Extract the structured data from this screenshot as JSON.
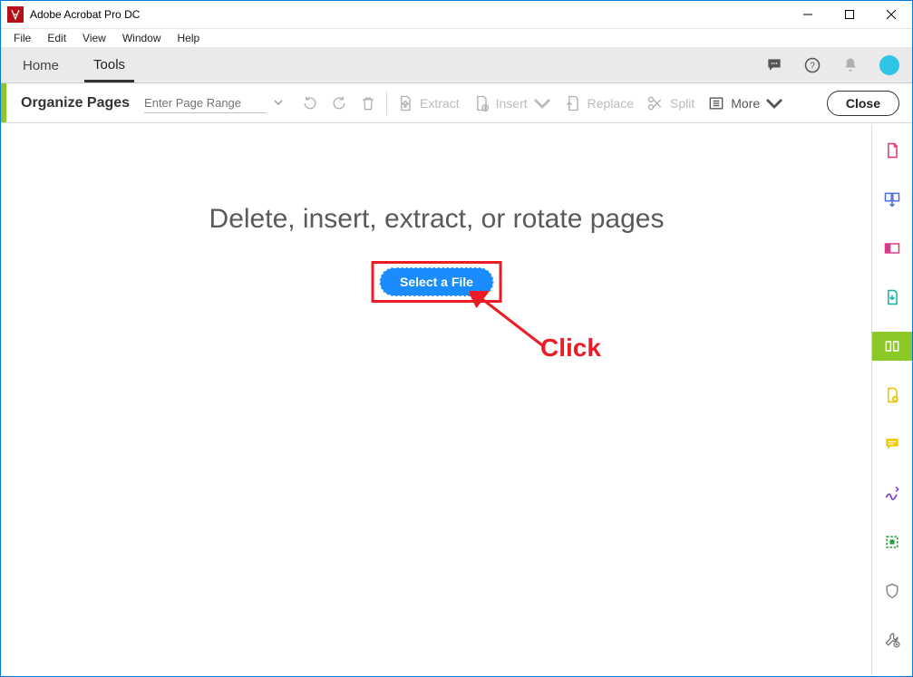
{
  "window": {
    "title": "Adobe Acrobat Pro DC"
  },
  "menubar": [
    "File",
    "Edit",
    "View",
    "Window",
    "Help"
  ],
  "app_tabs": {
    "home": "Home",
    "tools": "Tools",
    "active": "tools"
  },
  "toolbar": {
    "title": "Organize Pages",
    "page_range_placeholder": "Enter Page Range",
    "extract": "Extract",
    "insert": "Insert",
    "replace": "Replace",
    "split": "Split",
    "more": "More",
    "close": "Close"
  },
  "main": {
    "headline": "Delete, insert, extract, or rotate pages",
    "select_button": "Select a File"
  },
  "annotation": {
    "click": "Click"
  },
  "right_rail_icons": [
    "create-pdf-icon",
    "combine-files-icon",
    "edit-pdf-icon",
    "export-pdf-icon",
    "organize-pages-icon",
    "add-comments-icon",
    "sticky-note-icon",
    "fill-sign-icon",
    "stamp-icon",
    "protect-icon",
    "more-tools-icon"
  ],
  "colors": {
    "accent_green": "#8ac926",
    "annotation_red": "#ed1c24",
    "button_blue": "#1a8cff",
    "avatar": "#2dc4e8"
  }
}
